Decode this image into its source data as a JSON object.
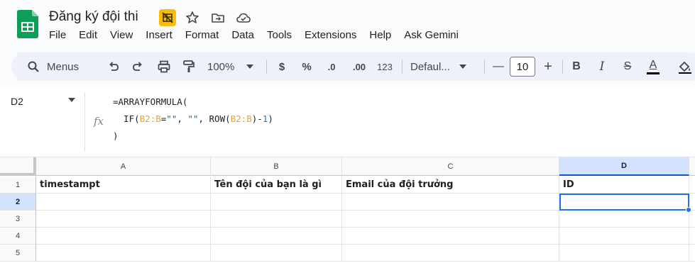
{
  "document": {
    "title": "Đăng ký đội thi"
  },
  "menu": [
    "File",
    "Edit",
    "View",
    "Insert",
    "Format",
    "Data",
    "Tools",
    "Extensions",
    "Help",
    "Ask Gemini"
  ],
  "toolbar": {
    "search_label": "Menus",
    "zoom": "100%",
    "currency": "$",
    "percent": "%",
    "decrease_decimal": ".0",
    "increase_decimal": ".00",
    "number_format": "123",
    "font": "Defaul...",
    "font_size": "10",
    "minus": "—",
    "plus": "+",
    "bold": "B",
    "italic": "I",
    "strike": "S",
    "text_color": "A"
  },
  "formula_bar": {
    "cell_ref": "D2",
    "fx": "fx",
    "line1": "=ARRAYFORMULA(",
    "line2_pre": "  IF(",
    "range1": "B2:B",
    "eq": "=",
    "str1": "\"\"",
    "comma1": ", ",
    "str2": "\"\"",
    "row_open": ", ROW(",
    "range2": "B2:B",
    "close_minus": ")-",
    "num": "1",
    "close": ")",
    "line3": ")"
  },
  "grid": {
    "columns": [
      "A",
      "B",
      "C",
      "D"
    ],
    "rows": [
      "1",
      "2",
      "3",
      "4",
      "5"
    ],
    "header_row": [
      "timestampt",
      "Tên đội của bạn là gì",
      "Email của đội trưởng",
      "ID"
    ],
    "selected_cell": "D2"
  },
  "colors": {
    "accent": "#1a73e8",
    "sheets_green": "#0f9d58",
    "toolbar_bg": "#edf2fa",
    "selected_header": "#d3e3fd"
  }
}
